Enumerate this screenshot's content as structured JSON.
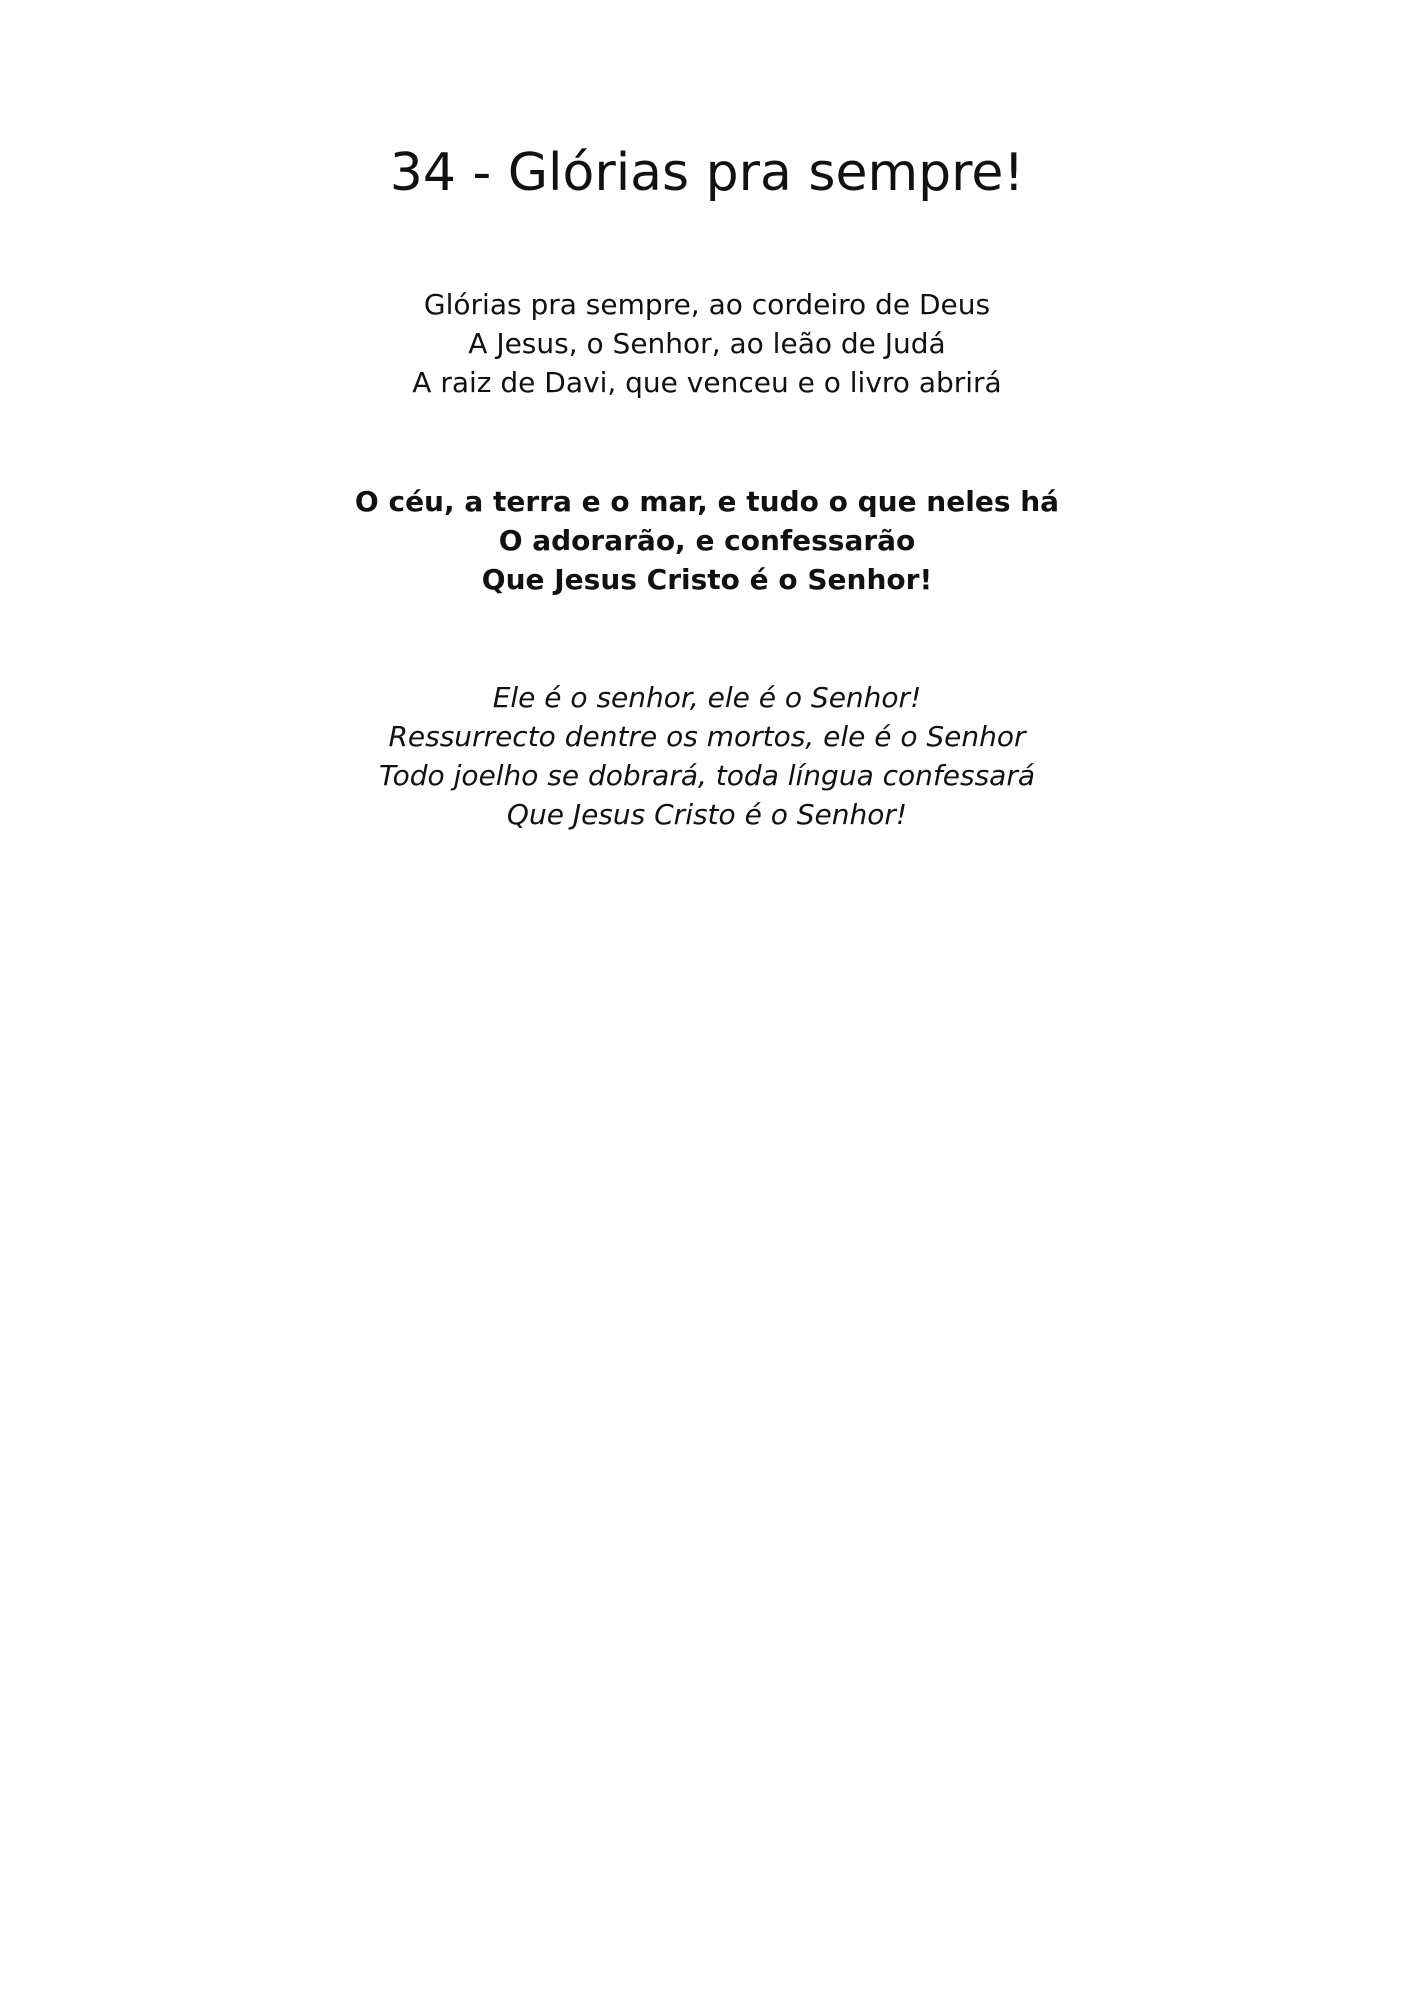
{
  "title": "34 - Glórias pra sempre!",
  "stanzas": [
    {
      "style": "regular",
      "lines": [
        "Glórias pra sempre, ao cordeiro de Deus",
        "A Jesus, o Senhor, ao leão de Judá",
        "A raiz de Davi, que venceu e o livro abrirá"
      ]
    },
    {
      "style": "bold",
      "lines": [
        "O céu, a terra e o mar, e tudo o que neles há",
        "O adorarão, e confessarão",
        "Que Jesus Cristo é o Senhor!"
      ]
    },
    {
      "style": "italic",
      "lines": [
        "Ele é o senhor, ele é o Senhor!",
        "Ressurrecto dentre os mortos, ele é o Senhor",
        "Todo joelho se dobrará, toda língua confessará",
        "Que Jesus Cristo é o Senhor!"
      ]
    }
  ]
}
